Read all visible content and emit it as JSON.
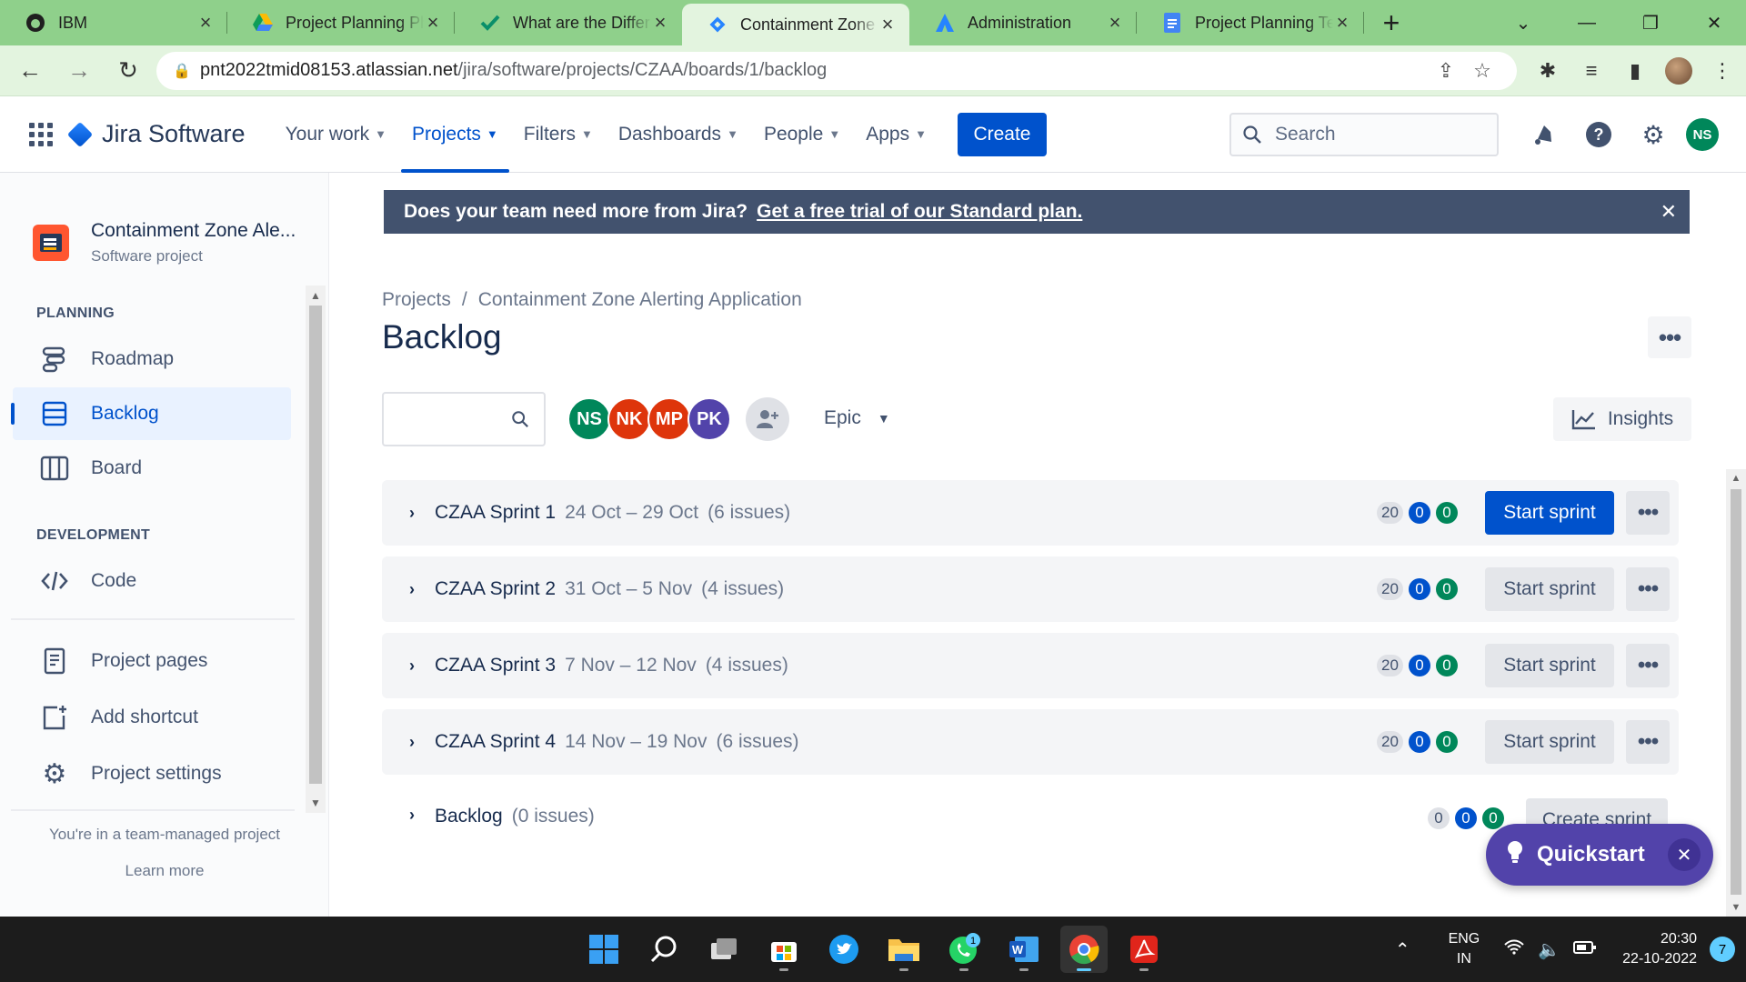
{
  "browser": {
    "tabs": [
      {
        "title": "IBM",
        "icon": "github-icon",
        "active": false
      },
      {
        "title": "Project Planning Ph",
        "icon": "google-drive-icon",
        "active": false
      },
      {
        "title": "What are the Differ",
        "icon": "check-icon",
        "active": false
      },
      {
        "title": "Containment Zone",
        "icon": "jira-icon",
        "active": true
      },
      {
        "title": "Administration",
        "icon": "atlassian-icon",
        "active": false
      },
      {
        "title": "Project Planning Te",
        "icon": "google-docs-icon",
        "active": false
      }
    ],
    "url_domain": "pnt2022tmid08153.atlassian.net",
    "url_path": "/jira/software/projects/CZAA/boards/1/backlog"
  },
  "jira_nav": {
    "product": "Jira Software",
    "menu": [
      {
        "label": "Your work",
        "active": false
      },
      {
        "label": "Projects",
        "active": true
      },
      {
        "label": "Filters",
        "active": false
      },
      {
        "label": "Dashboards",
        "active": false
      },
      {
        "label": "People",
        "active": false
      },
      {
        "label": "Apps",
        "active": false
      }
    ],
    "create_label": "Create",
    "search_placeholder": "Search",
    "user_initials": "NS"
  },
  "sidebar": {
    "project_name": "Containment Zone Ale...",
    "project_type": "Software project",
    "planning_heading": "PLANNING",
    "planning_items": [
      {
        "label": "Roadmap",
        "icon": "roadmap-icon",
        "active": false
      },
      {
        "label": "Backlog",
        "icon": "backlog-icon",
        "active": true
      },
      {
        "label": "Board",
        "icon": "board-icon",
        "active": false
      }
    ],
    "development_heading": "DEVELOPMENT",
    "development_items": [
      {
        "label": "Code",
        "icon": "code-icon"
      }
    ],
    "other_items": [
      {
        "label": "Project pages",
        "icon": "pages-icon"
      },
      {
        "label": "Add shortcut",
        "icon": "add-shortcut-icon"
      },
      {
        "label": "Project settings",
        "icon": "gear-icon"
      }
    ],
    "footer_text": "You're in a team-managed project",
    "learn_more": "Learn more"
  },
  "banner": {
    "text": "Does your team need more from Jira?",
    "link": "Get a free trial of our Standard plan."
  },
  "main": {
    "breadcrumb_projects": "Projects",
    "breadcrumb_separator": "/",
    "breadcrumb_project": "Containment Zone Alerting Application",
    "title": "Backlog",
    "avatars": [
      {
        "initials": "NS",
        "color": "#00875a"
      },
      {
        "initials": "NK",
        "color": "#de350b"
      },
      {
        "initials": "MP",
        "color": "#de350b"
      },
      {
        "initials": "PK",
        "color": "#5243aa"
      }
    ],
    "epic_label": "Epic",
    "insights_label": "Insights",
    "sprints": [
      {
        "name": "CZAA Sprint 1",
        "dates": "24 Oct – 29 Oct",
        "count": "(6 issues)",
        "points": [
          "20",
          "0",
          "0"
        ],
        "button": "Start sprint",
        "primary": true
      },
      {
        "name": "CZAA Sprint 2",
        "dates": "31 Oct – 5 Nov",
        "count": "(4 issues)",
        "points": [
          "20",
          "0",
          "0"
        ],
        "button": "Start sprint",
        "primary": false
      },
      {
        "name": "CZAA Sprint 3",
        "dates": "7 Nov – 12 Nov",
        "count": "(4 issues)",
        "points": [
          "20",
          "0",
          "0"
        ],
        "button": "Start sprint",
        "primary": false
      },
      {
        "name": "CZAA Sprint 4",
        "dates": "14 Nov – 19 Nov",
        "count": "(6 issues)",
        "points": [
          "20",
          "0",
          "0"
        ],
        "button": "Start sprint",
        "primary": false
      }
    ],
    "backlog": {
      "name": "Backlog",
      "count": "(0 issues)",
      "points": [
        "0",
        "0",
        "0"
      ],
      "button": "Create sprint"
    },
    "quickstart_label": "Quickstart"
  },
  "taskbar": {
    "whatsapp_badge": "1",
    "lang_line1": "ENG",
    "lang_line2": "IN",
    "time": "20:30",
    "date": "22-10-2022",
    "notifications": "7"
  },
  "colors": {
    "jira_blue": "#0052cc",
    "chrome_tab": "#8fd08b",
    "banner": "#42526e",
    "quickstart": "#5243aa"
  }
}
